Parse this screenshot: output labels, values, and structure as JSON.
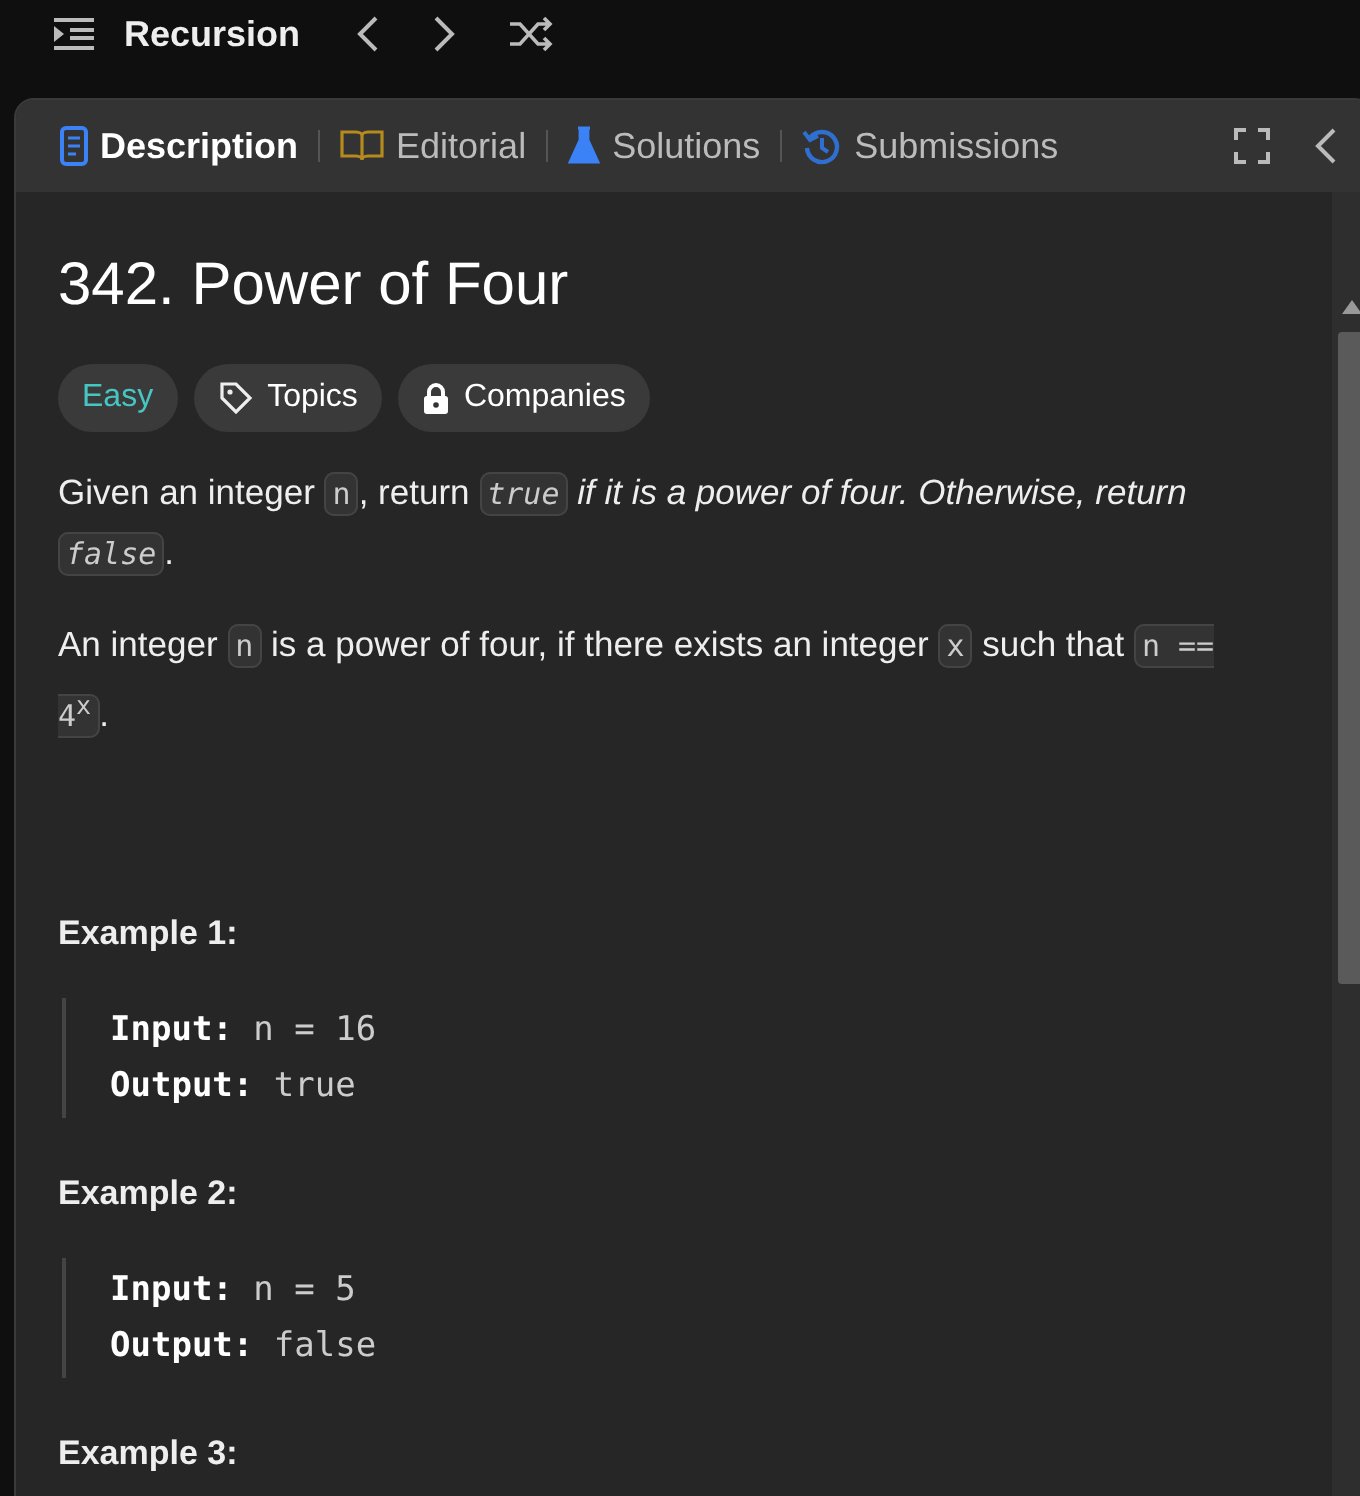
{
  "topbar": {
    "title": "Recursion"
  },
  "tabs": [
    {
      "label": "Description",
      "selected": true
    },
    {
      "label": "Editorial",
      "selected": false
    },
    {
      "label": "Solutions",
      "selected": false
    },
    {
      "label": "Submissions",
      "selected": false
    }
  ],
  "problem": {
    "title": "342. Power of Four",
    "tags": [
      {
        "label": "Easy",
        "kind": "difficulty"
      },
      {
        "label": "Topics",
        "kind": "topics"
      },
      {
        "label": "Companies",
        "kind": "companies"
      }
    ],
    "paragraphs": [
      [
        {
          "kind": "text",
          "text": "Given an integer "
        },
        {
          "kind": "code",
          "text": "n"
        },
        {
          "kind": "text",
          "text": ", return "
        },
        {
          "kind": "italic_code",
          "text": "true"
        },
        {
          "kind": "italic",
          "text": " if it is a power of four. Otherwise, return "
        },
        {
          "kind": "italic_code",
          "text": "false"
        },
        {
          "kind": "text",
          "text": "."
        }
      ],
      [
        {
          "kind": "text",
          "text": "An integer "
        },
        {
          "kind": "code",
          "text": "n"
        },
        {
          "kind": "text",
          "text": " is a power of four, if there exists an integer "
        },
        {
          "kind": "code",
          "text": "x"
        },
        {
          "kind": "text",
          "text": " such that "
        },
        {
          "kind": "code",
          "text": "n == 4$^{x}$"
        },
        {
          "kind": "text",
          "text": "."
        }
      ]
    ],
    "examples": [
      {
        "title": "Example 1:",
        "lines": [
          {
            "label": "Input:",
            "value": "n = 16"
          },
          {
            "label": "Output:",
            "value": "true"
          }
        ]
      },
      {
        "title": "Example 2:",
        "lines": [
          {
            "label": "Input:",
            "value": "n = 5"
          },
          {
            "label": "Output:",
            "value": "false"
          }
        ]
      },
      {
        "title": "Example 3:"
      }
    ]
  }
}
